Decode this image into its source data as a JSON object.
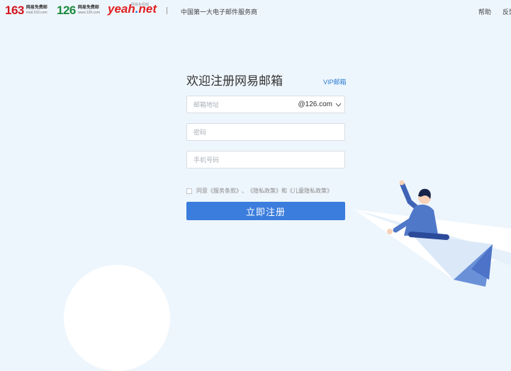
{
  "header": {
    "logo_163": {
      "num": "163",
      "line1": "网易免费邮",
      "line2": "mail.163.com"
    },
    "logo_126": {
      "num": "126",
      "line1": "网易免费邮",
      "line2": "www.126.com"
    },
    "logo_yeah": {
      "main": "yeah",
      "dot": ".",
      "tld": "net",
      "tag": "网易免费邮"
    },
    "slogan": "中国第一大电子邮件服务商",
    "help": "帮助",
    "feedback": "反馈"
  },
  "form": {
    "title": "欢迎注册网易邮箱",
    "vip_link": "VIP邮箱",
    "email_placeholder": "邮箱地址",
    "domain": "@126.com",
    "password_placeholder": "密码",
    "phone_placeholder": "手机号码",
    "agree": {
      "prefix": "同意",
      "terms": "《服务条款》",
      "sep1": "、",
      "privacy": "《隐私政策》",
      "and": "和",
      "child_privacy": "《儿童隐私政策》",
      "checked": false
    },
    "submit": "立即注册"
  },
  "colors": {
    "background": "#eef6fd",
    "primary_button": "#3b7ddd",
    "link": "#2b7cd3",
    "logo_163": "#d4151f",
    "logo_126": "#1d8a3c",
    "logo_yeah": "#e02020"
  },
  "icons": [
    "chevron-down-icon",
    "paper-plane-illustration",
    "person-illustration"
  ]
}
